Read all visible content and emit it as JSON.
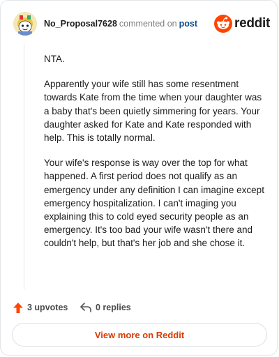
{
  "header": {
    "username": "No_Proposal7628",
    "commented_text": "commented on",
    "post_link": "post",
    "brand": "reddit"
  },
  "comment": {
    "paragraphs": [
      "NTA.",
      "Apparently your wife still has some resentment towards Kate from the time when your daughter was a baby that's been quietly simmering for years. Your daughter asked for Kate and Kate responded with help. This is totally normal.",
      "Your wife's response is way over the top for what happened. A first period does not qualify as an emergency under any definition I can imagine except emergency hospitalization. I can't imaging you explaining this to cold eyed security people as an emergency. It's too bad your wife wasn't there and couldn't help, but that's her job and she chose it."
    ]
  },
  "actions": {
    "upvotes": "3 upvotes",
    "replies": "0 replies"
  },
  "footer": {
    "view_button": "View more on Reddit"
  },
  "icons": {
    "avatar": "snoo-avatar-icon",
    "brand": "reddit-logo-icon",
    "upvote": "upvote-arrow-icon",
    "reply": "reply-arrow-icon"
  },
  "colors": {
    "accent": "#d93a00",
    "upvote": "#ff4500",
    "link": "#0a4a8c",
    "muted": "#7c7c7c"
  }
}
